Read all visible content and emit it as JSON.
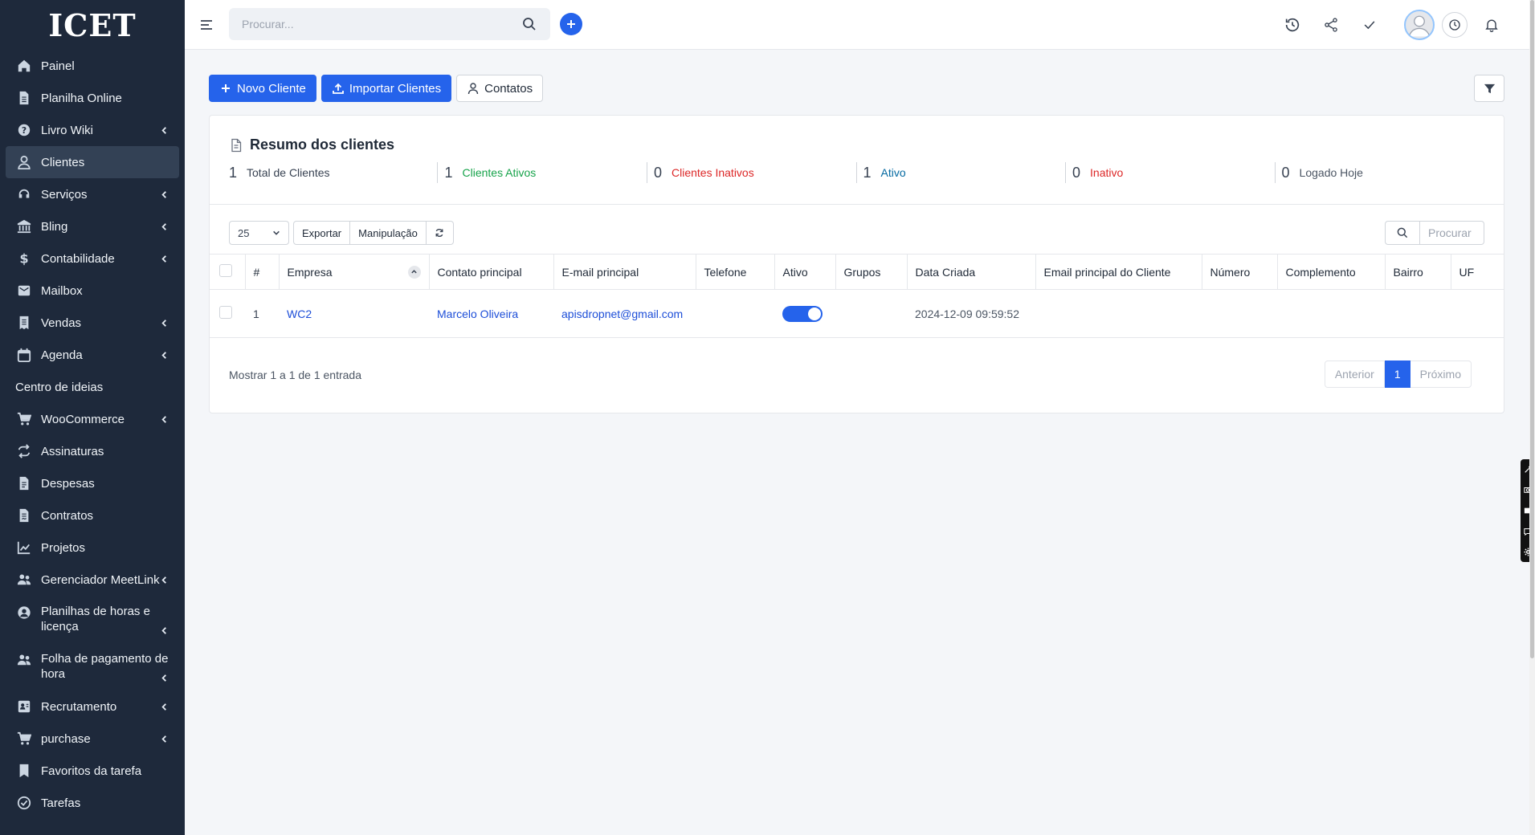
{
  "app": {
    "logo_text": "ICET"
  },
  "sidebar": {
    "items": [
      {
        "label": "Painel",
        "icon": "home-icon",
        "chevron": false
      },
      {
        "label": "Planilha Online",
        "icon": "file-icon",
        "chevron": false
      },
      {
        "label": "Livro Wiki",
        "icon": "question-circle-icon",
        "chevron": true
      },
      {
        "label": "Clientes",
        "icon": "user-icon",
        "chevron": false,
        "active": true
      },
      {
        "label": "Serviços",
        "icon": "support-icon",
        "chevron": true
      },
      {
        "label": "Bling",
        "icon": "bank-icon",
        "chevron": true
      },
      {
        "label": "Contabilidade",
        "icon": "dollar-icon",
        "chevron": true
      },
      {
        "label": "Mailbox",
        "icon": "envelope-icon",
        "chevron": false
      },
      {
        "label": "Vendas",
        "icon": "receipt-icon",
        "chevron": true
      },
      {
        "label": "Agenda",
        "icon": "calendar-icon",
        "chevron": true
      },
      {
        "label": "Centro de ideias",
        "icon": "",
        "chevron": false
      },
      {
        "label": "WooCommerce",
        "icon": "cart-icon",
        "chevron": true
      },
      {
        "label": "Assinaturas",
        "icon": "repeat-icon",
        "chevron": false
      },
      {
        "label": "Despesas",
        "icon": "file-text-icon",
        "chevron": false
      },
      {
        "label": "Contratos",
        "icon": "file-contract-icon",
        "chevron": false
      },
      {
        "label": "Projetos",
        "icon": "chart-icon",
        "chevron": false
      },
      {
        "label": "Gerenciador MeetLink",
        "icon": "users-icon",
        "chevron": true
      },
      {
        "label": "Planilhas de horas e licença",
        "icon": "user-circle-icon",
        "chevron": true
      },
      {
        "label": "Folha de pagamento de hora",
        "icon": "users-icon",
        "chevron": true
      },
      {
        "label": "Recrutamento",
        "icon": "id-card-icon",
        "chevron": true
      },
      {
        "label": "purchase",
        "icon": "cart-icon",
        "chevron": true
      },
      {
        "label": "Favoritos da tarefa",
        "icon": "bookmark-icon",
        "chevron": false
      },
      {
        "label": "Tarefas",
        "icon": "check-circle-icon",
        "chevron": false
      }
    ]
  },
  "header": {
    "search_placeholder": "Procurar..."
  },
  "toolbar": {
    "new_client": "Novo Cliente",
    "import_clients": "Importar Clientes",
    "contacts": "Contatos"
  },
  "summary": {
    "title": "Resumo dos clientes",
    "stats": [
      {
        "value": "1",
        "label": "Total de Clientes",
        "color": "#374151"
      },
      {
        "value": "1",
        "label": "Clientes Ativos",
        "color": "#16a34a"
      },
      {
        "value": "0",
        "label": "Clientes Inativos",
        "color": "#dc2626"
      },
      {
        "value": "1",
        "label": "Ativo",
        "color": "#0369a1"
      },
      {
        "value": "0",
        "label": "Inativo",
        "color": "#dc2626"
      },
      {
        "value": "0",
        "label": "Logado Hoje",
        "color": "#4b5563"
      }
    ]
  },
  "table_controls": {
    "page_size": "25",
    "export": "Exportar",
    "manipulation": "Manipulação",
    "search_placeholder": "Procurar"
  },
  "table": {
    "columns": [
      "#",
      "Empresa",
      "Contato principal",
      "E-mail principal",
      "Telefone",
      "Ativo",
      "Grupos",
      "Data Criada",
      "Email principal do Cliente",
      "Número",
      "Complemento",
      "Bairro",
      "UF"
    ],
    "rows": [
      {
        "id": "1",
        "empresa": "WC2",
        "contato": "Marcelo Oliveira",
        "email": "apisdropnet@gmail.com",
        "telefone": "",
        "ativo": true,
        "grupos": "",
        "data": "2024-12-09 09:59:52",
        "email_cliente": "",
        "numero": "",
        "complemento": "",
        "bairro": "",
        "uf": ""
      }
    ]
  },
  "footer": {
    "info": "Mostrar 1 a 1 de 1 entrada",
    "prev": "Anterior",
    "current": "1",
    "next": "Próximo"
  }
}
